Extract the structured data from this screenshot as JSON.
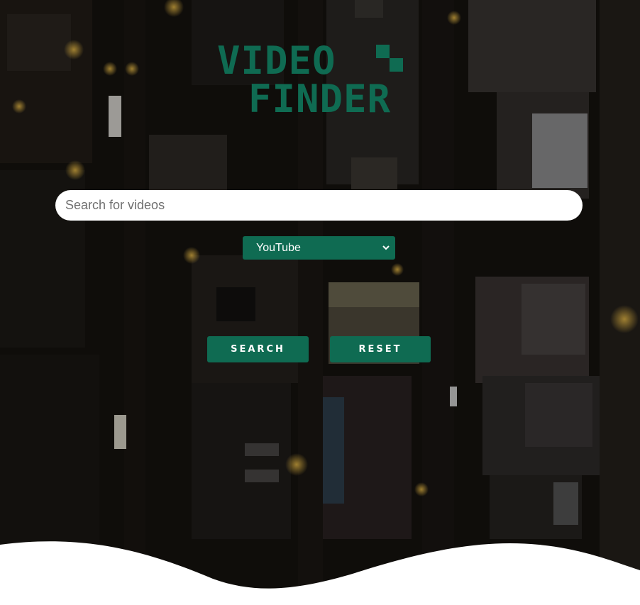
{
  "logo": {
    "line1": "VIDEO",
    "line2": "FINDER",
    "color": "#0f6b52"
  },
  "search": {
    "placeholder": "Search for videos",
    "value": ""
  },
  "source_select": {
    "selected": "YouTube"
  },
  "buttons": {
    "search_label": "SEARCH",
    "reset_label": "RESET"
  },
  "colors": {
    "accent": "#0f6b52",
    "background_overlay": "#141210"
  },
  "icons": {
    "select_chevron": "chevron-down-icon"
  }
}
